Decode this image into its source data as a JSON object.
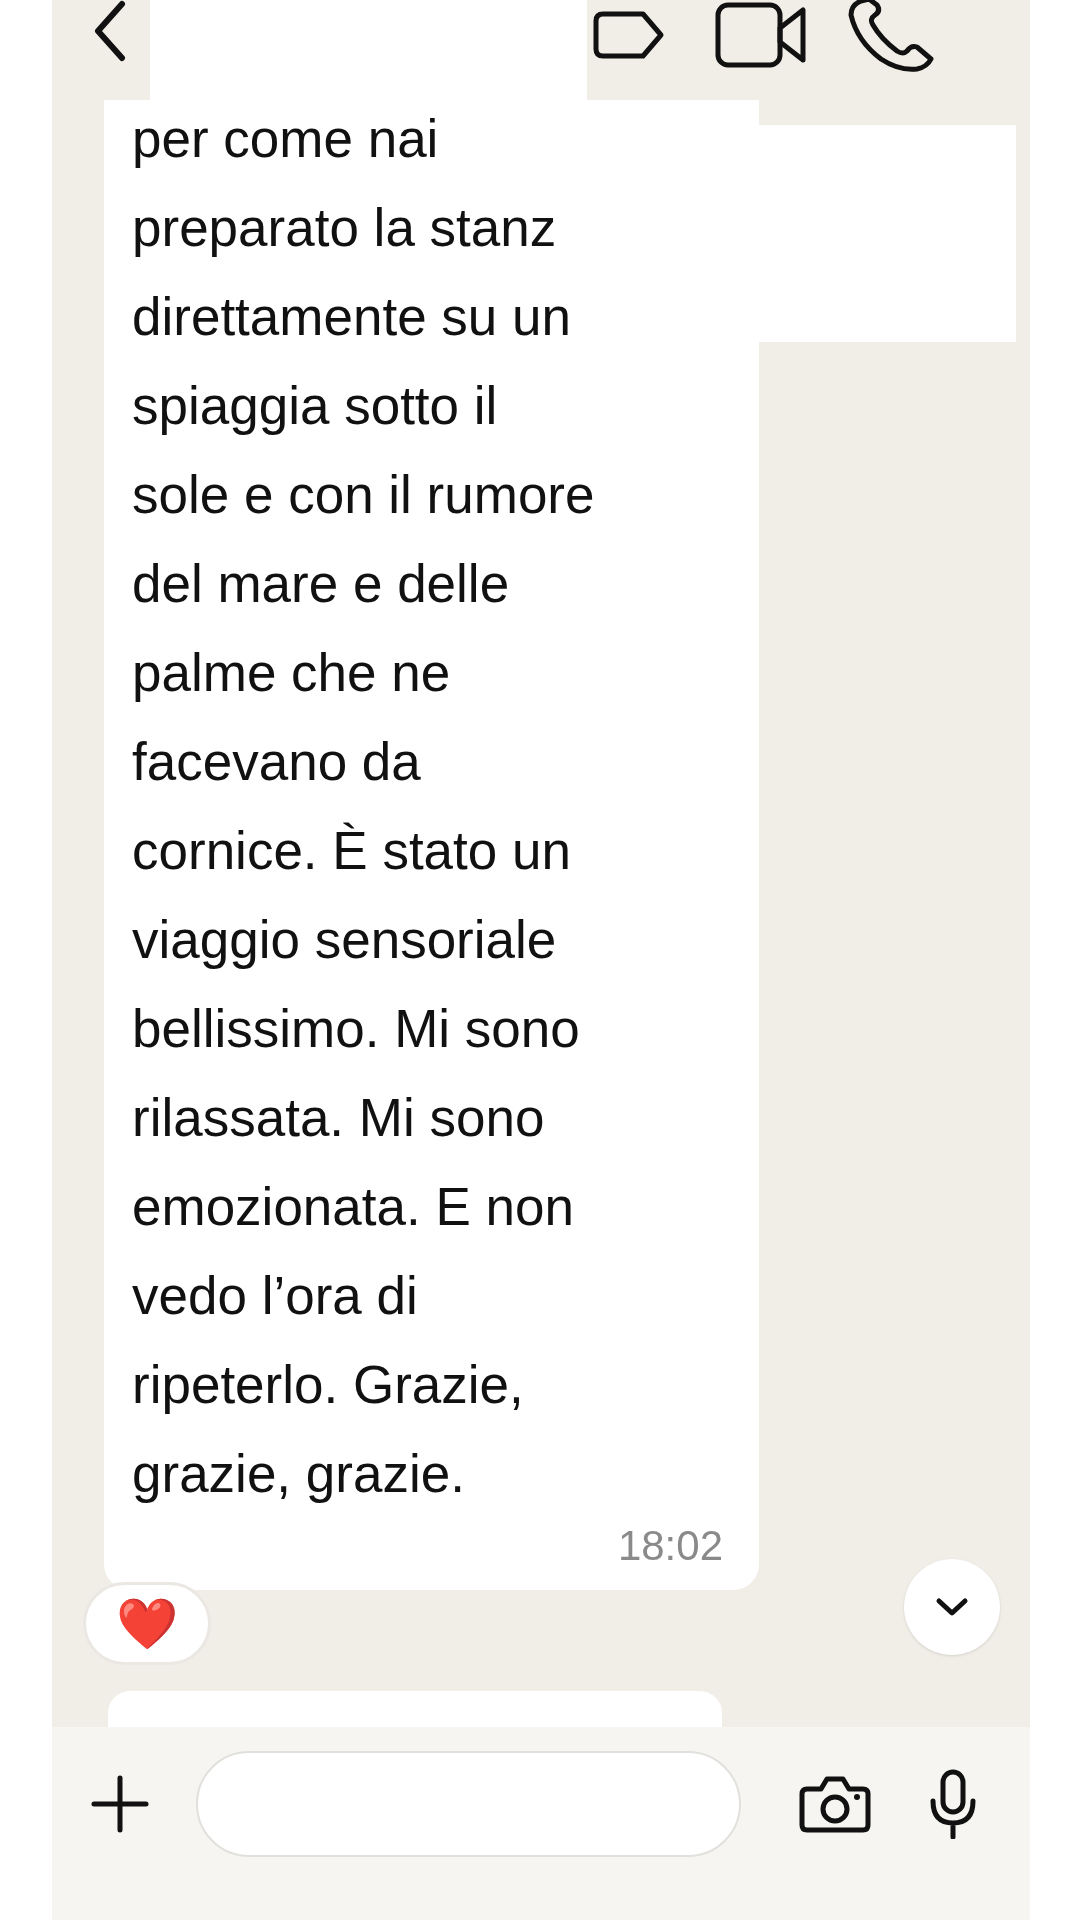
{
  "message": {
    "text": "per come nai\npreparato la stanz\ndirettamente su un\nspiaggia sotto il\nsole e con il rumore\ndel mare e delle\npalme che ne\nfacevano da\ncornice. È stato un\nviaggio sensoriale\nbellissimo. Mi sono\nrilassata. Mi sono\nemozionata. E non\nvedo l’ora di\nripeterlo. Grazie,\ngrazie, grazie.",
    "time": "18:02",
    "reaction": "❤️"
  }
}
